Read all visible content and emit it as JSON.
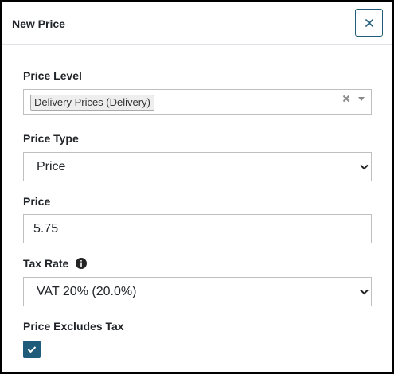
{
  "dialog": {
    "title": "New Price",
    "close_label": "×"
  },
  "fields": {
    "price_level": {
      "label": "Price Level",
      "selected_tags": [
        "Delivery Prices (Delivery)"
      ]
    },
    "price_type": {
      "label": "Price Type",
      "value": "Price"
    },
    "price": {
      "label": "Price",
      "value": "5.75"
    },
    "tax_rate": {
      "label": "Tax Rate",
      "value": "VAT 20% (20.0%)",
      "info_icon": "info-icon"
    },
    "price_excludes_tax": {
      "label": "Price Excludes Tax",
      "checked": true
    }
  },
  "colors": {
    "accent": "#1f5c7a",
    "border": "#bfbfbf",
    "tag_bg": "#eeeeee"
  }
}
